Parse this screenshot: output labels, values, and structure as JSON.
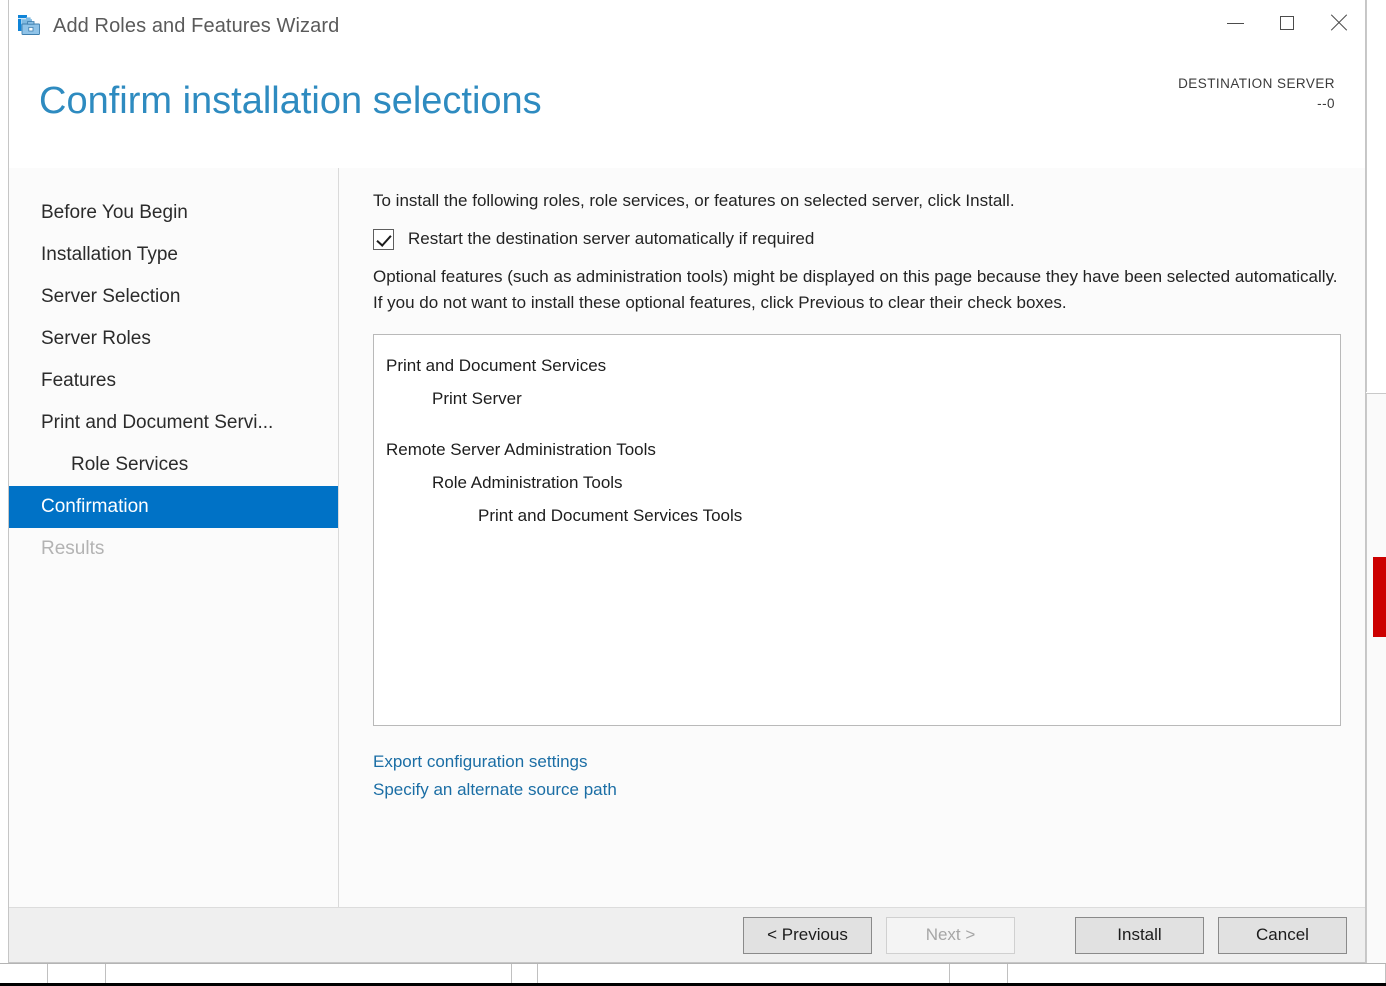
{
  "window": {
    "title": "Add Roles and Features Wizard",
    "app_icon": "server-toolbox-icon",
    "controls": {
      "minimize": "minimize-icon",
      "maximize": "maximize-icon",
      "close": "close-icon"
    }
  },
  "header": {
    "page_title": "Confirm installation selections",
    "destination_label": "DESTINATION SERVER",
    "destination_value": "--0",
    "accent_color": "#2e8bc0"
  },
  "sidebar": {
    "items": [
      {
        "label": "Before You Begin",
        "state": "normal",
        "indent": 0
      },
      {
        "label": "Installation Type",
        "state": "normal",
        "indent": 0
      },
      {
        "label": "Server Selection",
        "state": "normal",
        "indent": 0
      },
      {
        "label": "Server Roles",
        "state": "normal",
        "indent": 0
      },
      {
        "label": "Features",
        "state": "normal",
        "indent": 0
      },
      {
        "label": "Print and Document Servi...",
        "state": "normal",
        "indent": 0
      },
      {
        "label": "Role Services",
        "state": "normal",
        "indent": 1
      },
      {
        "label": "Confirmation",
        "state": "active",
        "indent": 0
      },
      {
        "label": "Results",
        "state": "disabled",
        "indent": 0
      }
    ],
    "active_color": "#0072c6"
  },
  "main": {
    "intro": "To install the following roles, role services, or features on selected server, click Install.",
    "restart_checkbox": {
      "label": "Restart the destination server automatically if required",
      "checked": true
    },
    "note": "Optional features (such as administration tools) might be displayed on this page because they have been selected automatically. If you do not want to install these optional features, click Previous to clear their check boxes.",
    "selections": [
      {
        "text": "Print and Document Services",
        "level": 1
      },
      {
        "text": "Print Server",
        "level": 2
      },
      {
        "text": "",
        "level": 0
      },
      {
        "text": "Remote Server Administration Tools",
        "level": 1
      },
      {
        "text": "Role Administration Tools",
        "level": 2
      },
      {
        "text": "Print and Document Services Tools",
        "level": 3
      }
    ],
    "links": [
      "Export configuration settings",
      "Specify an alternate source path"
    ],
    "link_color": "#1b6ea5"
  },
  "footer": {
    "buttons": [
      {
        "label": "< Previous",
        "state": "enabled",
        "name": "previous-button"
      },
      {
        "label": "Next >",
        "state": "disabled",
        "name": "next-button"
      },
      {
        "label": "Install",
        "state": "enabled",
        "name": "install-button"
      },
      {
        "label": "Cancel",
        "state": "enabled",
        "name": "cancel-button"
      }
    ]
  }
}
